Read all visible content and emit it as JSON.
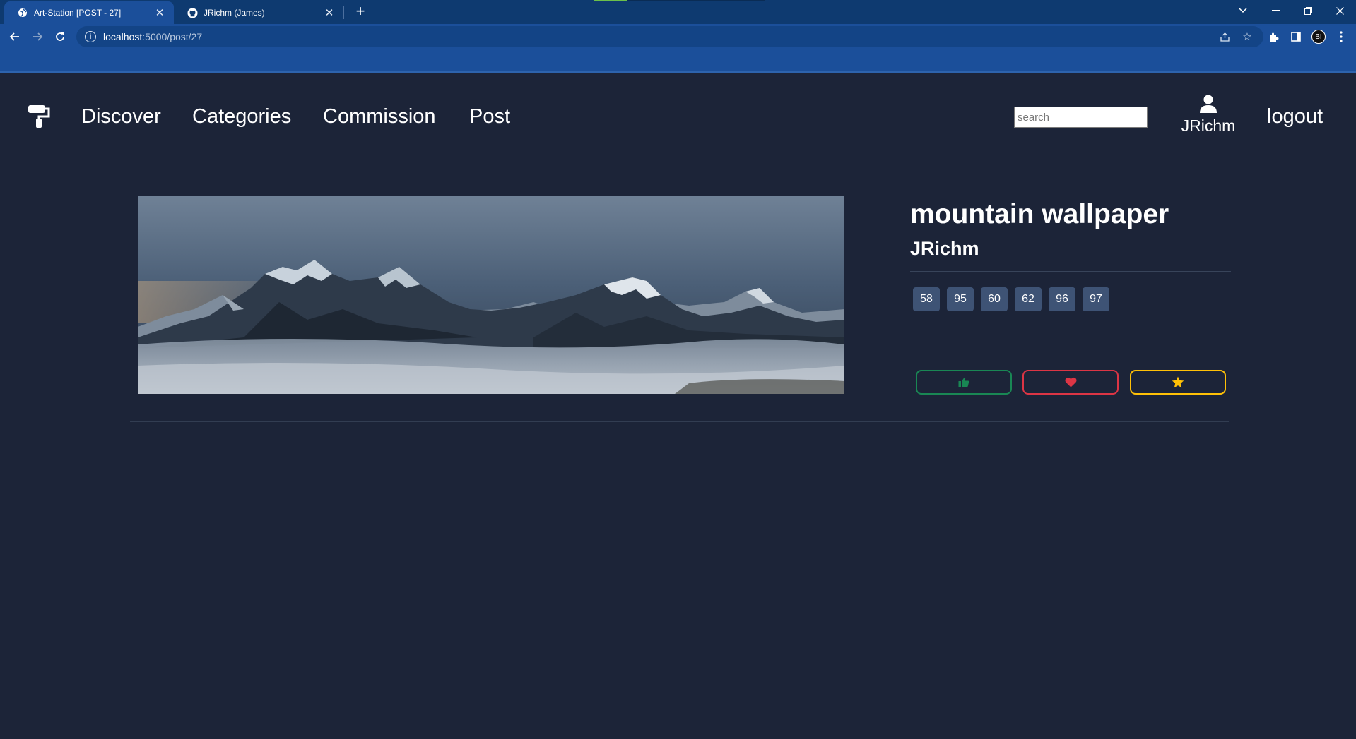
{
  "browser": {
    "tabs": [
      {
        "title": "Art-Station [POST - 27]",
        "active": true
      },
      {
        "title": "JRichm (James)",
        "active": false
      }
    ],
    "url": {
      "host": "localhost",
      "path": ":5000/post/27"
    },
    "profile_initials": "BI"
  },
  "nav": {
    "links": [
      "Discover",
      "Categories",
      "Commission",
      "Post"
    ],
    "search_placeholder": "search",
    "username": "JRichm",
    "logout_label": "logout"
  },
  "post": {
    "title": "mountain wallpaper",
    "author": "JRichm",
    "tags": [
      "58",
      "95",
      "60",
      "62",
      "96",
      "97"
    ]
  },
  "colors": {
    "page_bg": "#1c2438",
    "like": "#198754",
    "love": "#dc3545",
    "favorite": "#ffc107",
    "tag_bg": "#3e5375"
  },
  "icons": {
    "like": "thumbs-up-icon",
    "love": "heart-icon",
    "favorite": "star-icon"
  }
}
